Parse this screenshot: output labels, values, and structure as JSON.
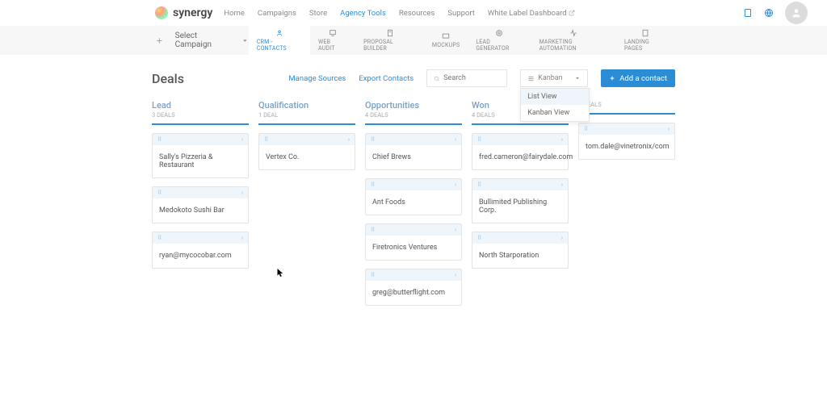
{
  "brand": "synergy",
  "nav": {
    "home": "Home",
    "campaigns": "Campaigns",
    "store": "Store",
    "agency": "Agency Tools",
    "resources": "Resources",
    "support": "Support",
    "whitelabel": "White Label Dashboard"
  },
  "subbar": {
    "select": "Select Campaign"
  },
  "tools": {
    "crm": "CRM - CONTACTS",
    "audit": "WEB AUDIT",
    "proposal": "PROPOSAL BUILDER",
    "mockups": "MOCKUPS",
    "leadgen": "LEAD GENERATOR",
    "automation": "MARKETING AUTOMATION",
    "landing": "LANDING PAGES"
  },
  "page": {
    "title": "Deals",
    "manage": "Manage Sources",
    "export": "Export Contacts",
    "searchPlaceholder": "Search",
    "viewLabel": "Kanban",
    "dd1": "List View",
    "dd2": "Kanban View",
    "addContact": "Add a contact"
  },
  "cols": {
    "lead": {
      "title": "Lead",
      "sub": "3 DEALS",
      "cards": [
        "Sally's Pizzeria & Restaurant",
        "Medokoto Sushi Bar",
        "ryan@mycocobar.com"
      ]
    },
    "qual": {
      "title": "Qualification",
      "sub": "1 DEAL",
      "cards": [
        "Vertex Co."
      ]
    },
    "opp": {
      "title": "Opportunities",
      "sub": "4 DEALS",
      "cards": [
        "Chief Brews",
        "Ant Foods",
        "Firetronics Ventures",
        "greg@butterflight.com"
      ]
    },
    "won": {
      "title": "Won",
      "sub": "4 DEALS",
      "cards": [
        "fred.cameron@fairydale.com",
        "Bullimited Publishing Corp.",
        "North Starporation"
      ]
    },
    "c5": {
      "title": "",
      "sub": "1 DEALS",
      "cards": [
        "tom.dale@vinetronix/com"
      ]
    }
  }
}
